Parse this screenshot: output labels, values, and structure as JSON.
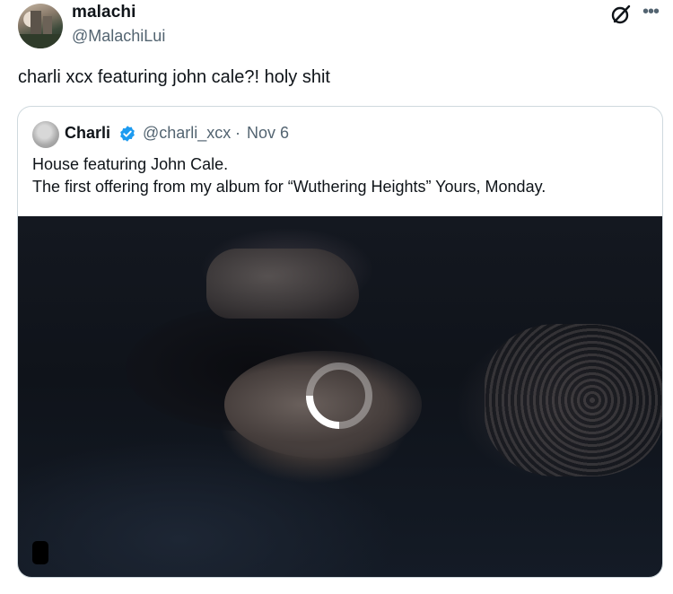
{
  "author": {
    "display_name": "malachi",
    "handle": "@MalachiLui"
  },
  "tweet": {
    "text": "charli xcx featuring john cale?! holy shit"
  },
  "quote": {
    "display_name": "Charli",
    "handle": "@charli_xcx",
    "separator": "·",
    "date": "Nov 6",
    "lines": [
      "House featuring John Cale.",
      "The first offering from my album for “Wuthering Heights” Yours, Monday."
    ]
  },
  "icons": {
    "grok": "grok-icon",
    "more": "more-icon",
    "verified": "verified-badge-icon",
    "loading": "loading-spinner-icon"
  },
  "colors": {
    "text": "#0f1419",
    "secondary": "#536471",
    "border": "#cfd9de",
    "verified": "#1d9bf0"
  }
}
